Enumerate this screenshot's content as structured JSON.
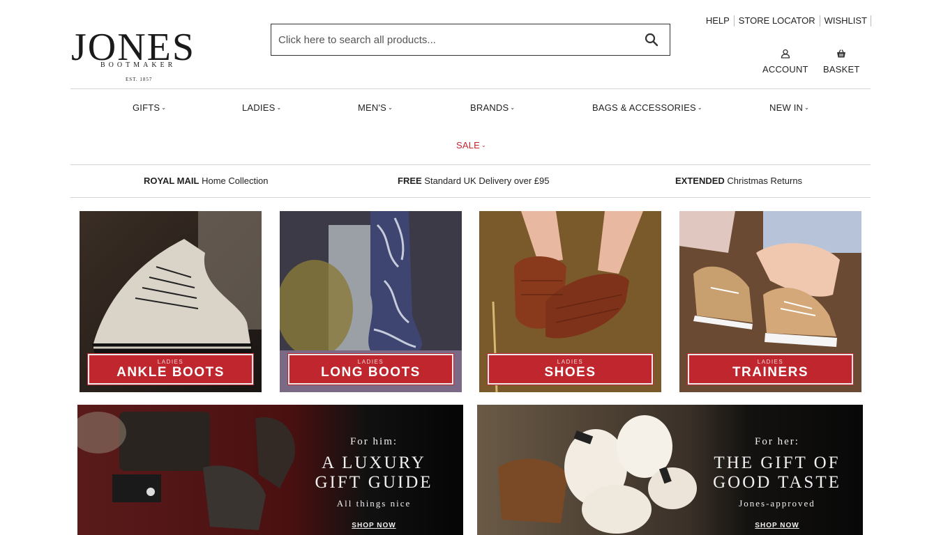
{
  "brand": {
    "name": "JONES",
    "sub": "BOOTMAKER",
    "est": "EST. 1857"
  },
  "search": {
    "placeholder": "Click here to search all products..."
  },
  "util_links": [
    "HELP",
    "STORE LOCATOR",
    "WISHLIST"
  ],
  "account": {
    "label": "ACCOUNT",
    "icon": "user-icon"
  },
  "basket": {
    "label": "BASKET",
    "icon": "basket-icon"
  },
  "nav": {
    "items": [
      "GIFTS",
      "LADIES",
      "MEN'S",
      "BRANDS",
      "BAGS & ACCESSORIES",
      "NEW IN"
    ],
    "sale": "SALE"
  },
  "usp": [
    {
      "bold": "ROYAL MAIL",
      "text": " Home Collection"
    },
    {
      "bold": "FREE",
      "text": " Standard UK Delivery over £95"
    },
    {
      "bold": "EXTENDED",
      "text": " Christmas Returns"
    }
  ],
  "tiles": [
    {
      "small": "LADIES",
      "big": "ANKLE BOOTS"
    },
    {
      "small": "LADIES",
      "big": "LONG BOOTS"
    },
    {
      "small": "LADIES",
      "big": "SHOES"
    },
    {
      "small": "LADIES",
      "big": "TRAINERS"
    }
  ],
  "promos": [
    {
      "for": "For him:",
      "line1": "A LUXURY",
      "line2": "GIFT GUIDE",
      "tag": "All things nice",
      "cta": "SHOP NOW"
    },
    {
      "for": "For her:",
      "line1": "THE GIFT OF",
      "line2": "GOOD TASTE",
      "tag": "Jones-approved",
      "cta": "SHOP NOW"
    }
  ],
  "colors": {
    "accent_red": "#c0262d",
    "text": "#222222",
    "divider": "#d4d4d4"
  }
}
